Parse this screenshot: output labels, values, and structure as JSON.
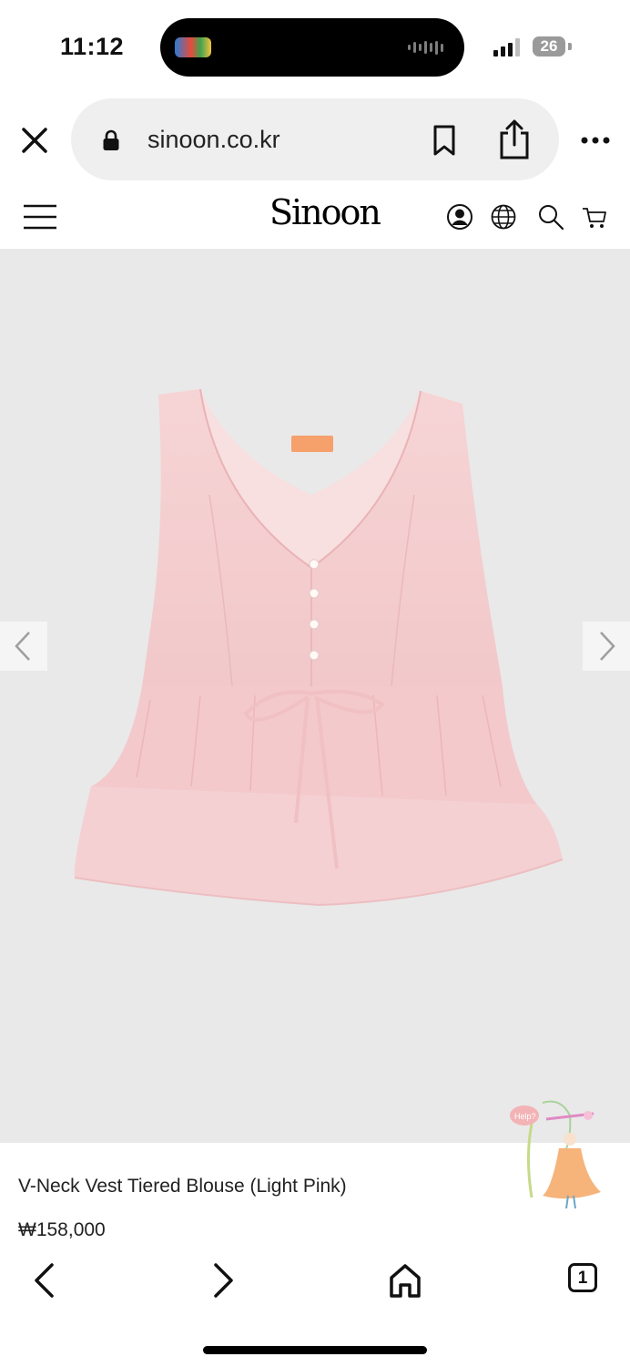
{
  "status_bar": {
    "time": "11:12",
    "battery": "26"
  },
  "browser": {
    "url": "sinoon.co.kr",
    "tab_count": "1",
    "icons": [
      "close-icon",
      "lock-icon",
      "bookmark-icon",
      "share-icon",
      "more-icon",
      "back-icon",
      "forward-icon",
      "home-icon"
    ]
  },
  "site": {
    "logo": "Sinoon",
    "header_icons": [
      "menu-icon",
      "account-icon",
      "globe-icon",
      "search-icon",
      "cart-icon"
    ]
  },
  "product": {
    "name": "V-Neck Vest Tiered Blouse (Light Pink)",
    "price": "₩158,000",
    "image_background": "#e9e9e9",
    "garment_color": "#f4cfd1"
  },
  "help_widget": {
    "label": "Help?"
  }
}
